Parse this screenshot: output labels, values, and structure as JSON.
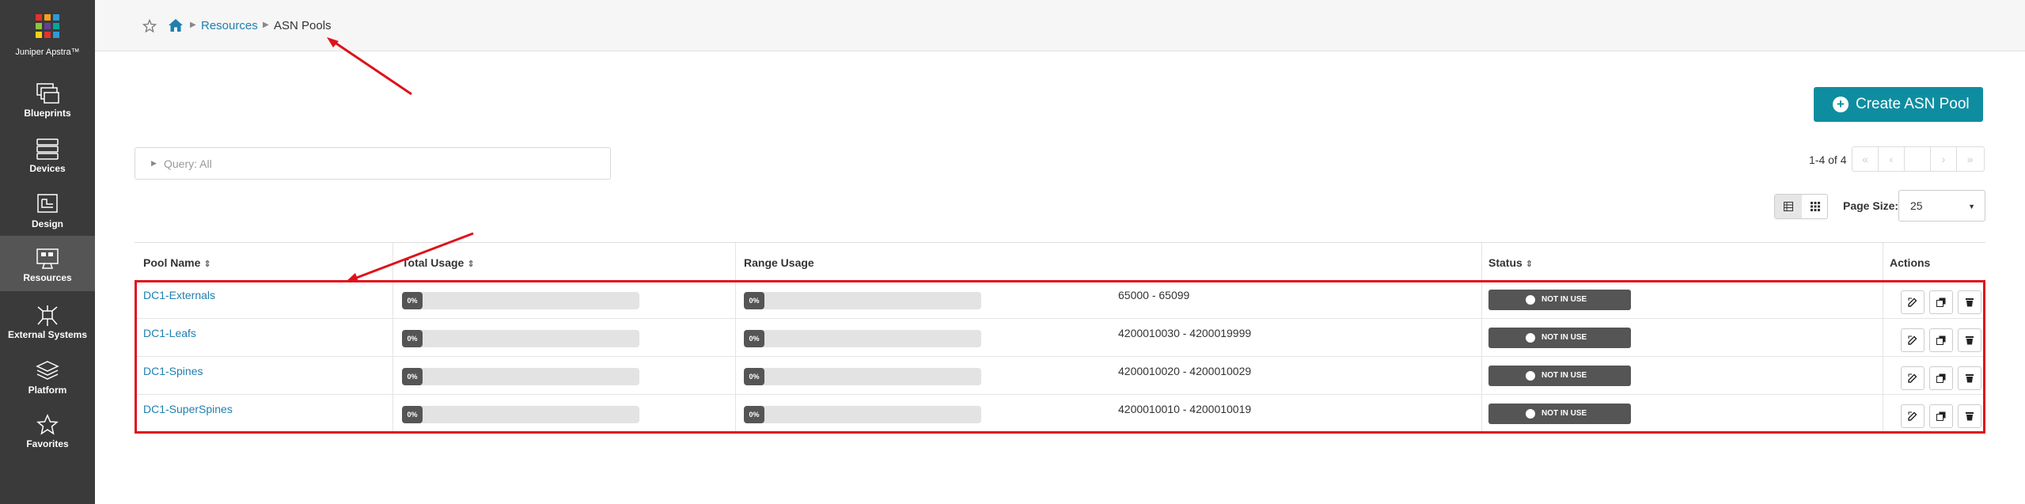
{
  "sidebar": {
    "logo_text": "Juniper Apstra™",
    "logo_colors": [
      "#e6312b",
      "#f5a21b",
      "#2e9bd6",
      "#8cc63f",
      "#6a3e98",
      "#00a79d",
      "#f7d117",
      "#e6312b",
      "#2e9bd6"
    ],
    "items": [
      {
        "label": "Blueprints",
        "icon": "blueprints-icon"
      },
      {
        "label": "Devices",
        "icon": "devices-icon"
      },
      {
        "label": "Design",
        "icon": "design-icon"
      },
      {
        "label": "Resources",
        "icon": "resources-icon",
        "active": true
      },
      {
        "label": "External Systems",
        "icon": "external-systems-icon"
      },
      {
        "label": "Platform",
        "icon": "platform-icon"
      },
      {
        "label": "Favorites",
        "icon": "star-icon"
      }
    ]
  },
  "breadcrumb": {
    "resources": "Resources",
    "current": "ASN Pools"
  },
  "toolbar": {
    "create_label": "Create ASN Pool",
    "query_label": "Query: All",
    "pagination_count": "1-4 of 4",
    "page_size_label": "Page Size:",
    "page_size_value": "25"
  },
  "table": {
    "headers": {
      "pool_name": "Pool Name",
      "total_usage": "Total Usage",
      "range_usage": "Range Usage",
      "status": "Status",
      "actions": "Actions"
    },
    "rows": [
      {
        "name": "DC1-Externals",
        "total_usage": "0%",
        "total_usage_value": 0,
        "range_usage": "0%",
        "range_usage_value": 0,
        "range": "65000 - 65099",
        "status": "NOT IN USE"
      },
      {
        "name": "DC1-Leafs",
        "total_usage": "0%",
        "total_usage_value": 0,
        "range_usage": "0%",
        "range_usage_value": 0,
        "range": "4200010030 - 4200019999",
        "status": "NOT IN USE"
      },
      {
        "name": "DC1-Spines",
        "total_usage": "0%",
        "total_usage_value": 0,
        "range_usage": "0%",
        "range_usage_value": 0,
        "range": "4200010020 - 4200010029",
        "status": "NOT IN USE"
      },
      {
        "name": "DC1-SuperSpines",
        "total_usage": "0%",
        "total_usage_value": 0,
        "range_usage": "0%",
        "range_usage_value": 0,
        "range": "4200010010 - 4200010019",
        "status": "NOT IN USE"
      }
    ]
  },
  "colors": {
    "accent": "#0f8da0",
    "link": "#1f7fae",
    "sidebar": "#3a3a3a",
    "annotation": "#e0101a"
  }
}
